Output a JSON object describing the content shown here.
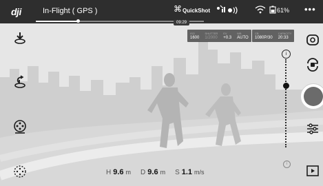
{
  "statusbar": {
    "logo": "dji",
    "flight_mode": "In-Flight ( GPS )",
    "progress": 0.25,
    "elapsed": "09:29",
    "quickshot_label": "QuickShot",
    "battery": "61%"
  },
  "camera_settings": {
    "iso_label": "ISO",
    "iso": "1600",
    "shutter_label": "SHUTTER",
    "shutter": "1/2000",
    "ev_label": "EV",
    "ev": "+0.3",
    "wb_label": "WB",
    "wb": "AUTO",
    "res_label": "CB",
    "resolution": "1080P/30",
    "capacity_label": "CAPACITY",
    "capacity": "20:33"
  },
  "left_toolbar": {
    "icons": [
      "auto-land-icon",
      "return-home-icon",
      "intelligent-flight-icon",
      "obstacle-sensing-icon"
    ]
  },
  "right_toolbar": {
    "icons": [
      "camera-switch-icon",
      "mode-toggle-icon",
      "shutter-button",
      "camera-settings-icon",
      "playback-icon"
    ]
  },
  "slider": {
    "level": 0.3
  },
  "telemetry": {
    "h_label": "H",
    "h_value": "9.6",
    "h_unit": "m",
    "d_label": "D",
    "d_value": "9.6",
    "d_unit": "m",
    "s_label": "S",
    "s_value": "1.1",
    "s_unit": "m/s"
  },
  "colors": {
    "statusbar_bg": "#2e2e2e",
    "shutter_inner": "#6b6b6b",
    "sky": "#e7e7e7"
  }
}
